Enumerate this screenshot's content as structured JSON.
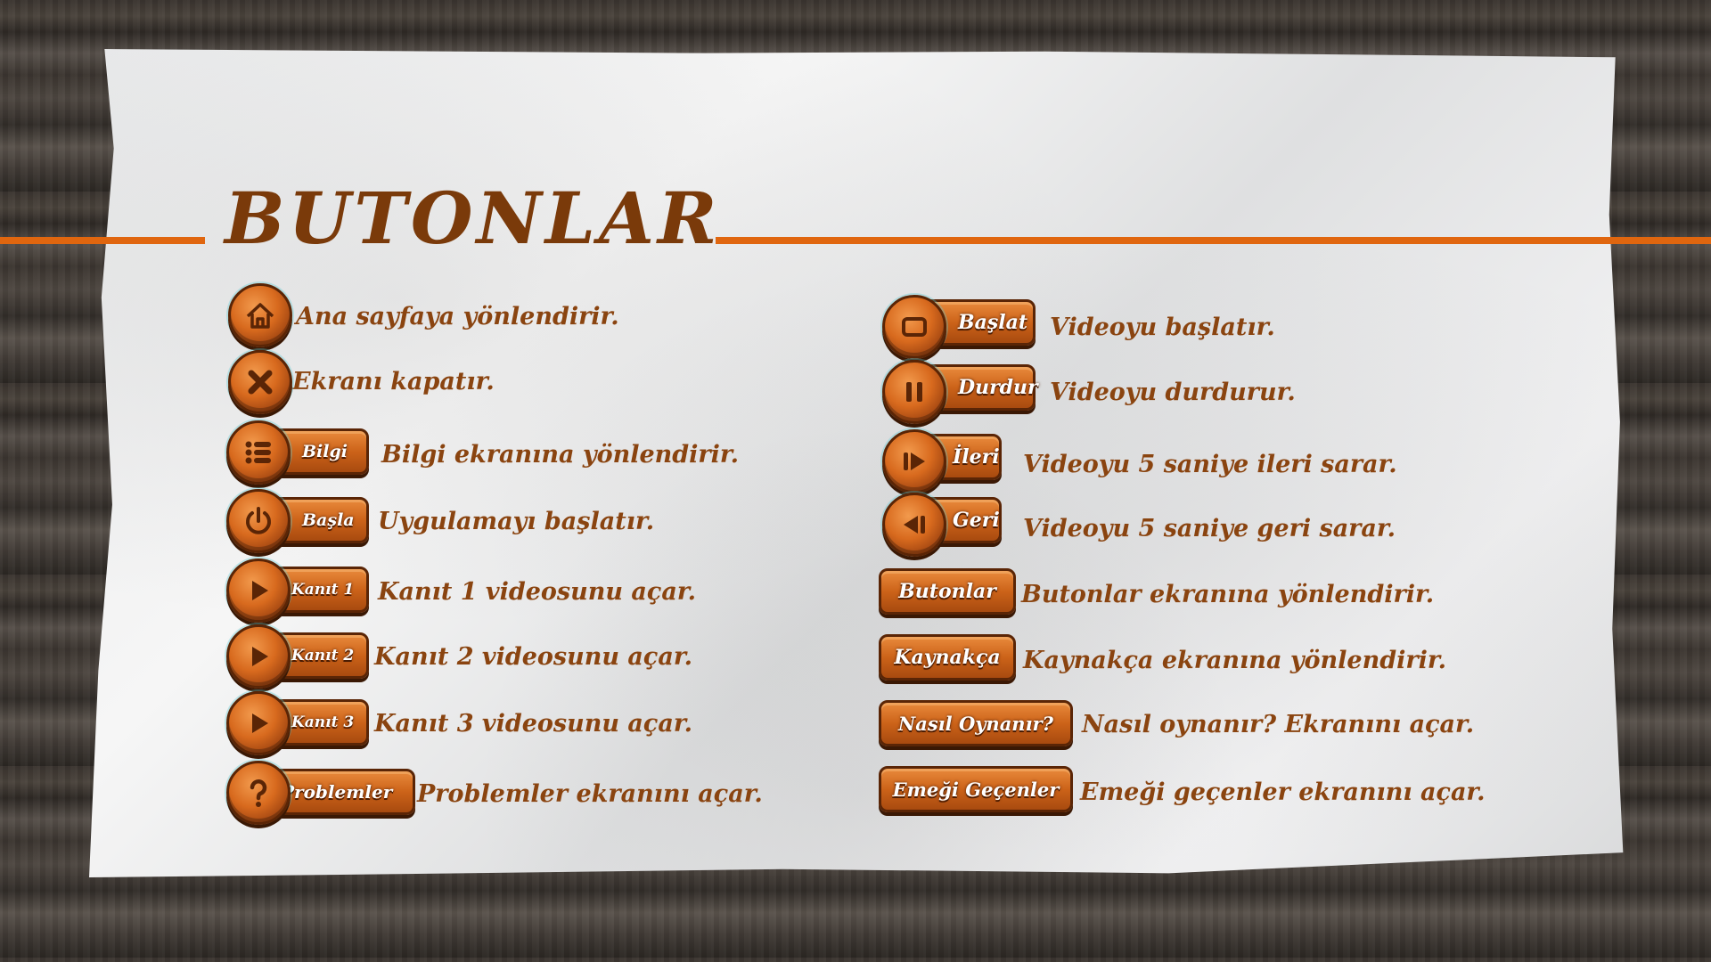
{
  "title": "BUTONLAR",
  "colors": {
    "accent_line": "#e0660f",
    "title": "#7a3a0a",
    "description": "#8a4410",
    "button": "#cc6319"
  },
  "left_column": [
    {
      "icon": "home-icon",
      "label": "",
      "description": "Ana sayfaya yönlendirir."
    },
    {
      "icon": "close-icon",
      "label": "",
      "description": "Ekranı kapatır."
    },
    {
      "icon": "list-icon",
      "label": "Bilgi",
      "description": "Bilgi ekranına yönlendirir."
    },
    {
      "icon": "power-icon",
      "label": "Başla",
      "description": "Uygulamayı başlatır."
    },
    {
      "icon": "play-icon",
      "label": "Kanıt 1",
      "description": "Kanıt 1 videosunu açar."
    },
    {
      "icon": "play-icon",
      "label": "Kanıt 2",
      "description": "Kanıt 2 videosunu açar."
    },
    {
      "icon": "play-icon",
      "label": "Kanıt 3",
      "description": "Kanıt 3 videosunu açar."
    },
    {
      "icon": "question-icon",
      "label": "Problemler",
      "description": "Problemler ekranını açar."
    }
  ],
  "right_column": [
    {
      "icon": "stop-icon",
      "label": "Başlat",
      "description": "Videoyu başlatır."
    },
    {
      "icon": "pause-icon",
      "label": "Durdur",
      "description": "Videoyu durdurur."
    },
    {
      "icon": "forward-icon",
      "label": "İleri",
      "description": "Videoyu 5 saniye ileri sarar."
    },
    {
      "icon": "rewind-icon",
      "label": "Geri",
      "description": "Videoyu 5 saniye geri sarar."
    },
    {
      "icon": "",
      "label": "Butonlar",
      "description": "Butonlar ekranına yönlendirir."
    },
    {
      "icon": "",
      "label": "Kaynakça",
      "description": "Kaynakça ekranına yönlendirir."
    },
    {
      "icon": "",
      "label": "Nasıl Oynanır?",
      "description": "Nasıl oynanır? Ekranını açar."
    },
    {
      "icon": "",
      "label": "Emeği Geçenler",
      "description": "Emeği geçenler ekranını açar."
    }
  ]
}
